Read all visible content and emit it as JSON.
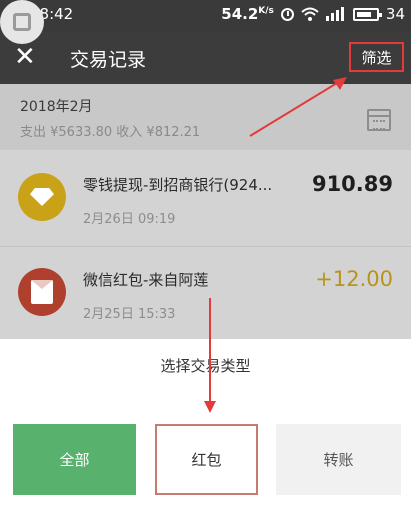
{
  "status_bar": {
    "time": "18:42",
    "speed": "54.2",
    "speed_unit": "K/s",
    "battery": "34"
  },
  "header": {
    "title": "交易记录",
    "filter_label": "筛选"
  },
  "month": {
    "title": "2018年2月",
    "summary": "支出 ¥5633.80 收入 ¥812.21"
  },
  "transactions": [
    {
      "title": "零钱提现-到招商银行(924...",
      "date": "2月26日 09:19",
      "amount": "910.89",
      "icon": "diamond-icon"
    },
    {
      "title": "微信红包-来自阿莲",
      "date": "2月25日 15:33",
      "amount": "+12.00",
      "icon": "red-envelope-icon"
    }
  ],
  "sheet": {
    "title": "选择交易类型",
    "options": [
      "全部",
      "红包",
      "转账"
    ]
  },
  "colors": {
    "accent_green": "#58b16c",
    "annotation_red": "#e33b3b",
    "income_gold": "#b8941c"
  }
}
